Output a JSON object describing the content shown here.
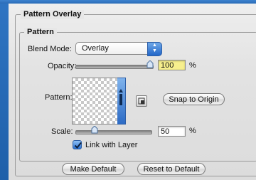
{
  "panel": {
    "title": "Pattern Overlay",
    "group_title": "Pattern"
  },
  "blend_mode": {
    "label": "Blend Mode:",
    "value": "Overlay"
  },
  "opacity": {
    "label": "Opacity:",
    "value": "100",
    "unit": "%",
    "level": 1.0
  },
  "pattern": {
    "label": "Pattern:",
    "snap_button": "Snap to Origin"
  },
  "scale": {
    "label": "Scale:",
    "value": "50",
    "unit": "%",
    "level": 0.26
  },
  "link_with_layer": {
    "label": "Link with Layer",
    "checked": true
  },
  "footer": {
    "make_default": "Make Default",
    "reset_default": "Reset to Default"
  },
  "colors": {
    "accent_blue": "#2a6fd0",
    "highlight_input": "#f7ef8d"
  }
}
